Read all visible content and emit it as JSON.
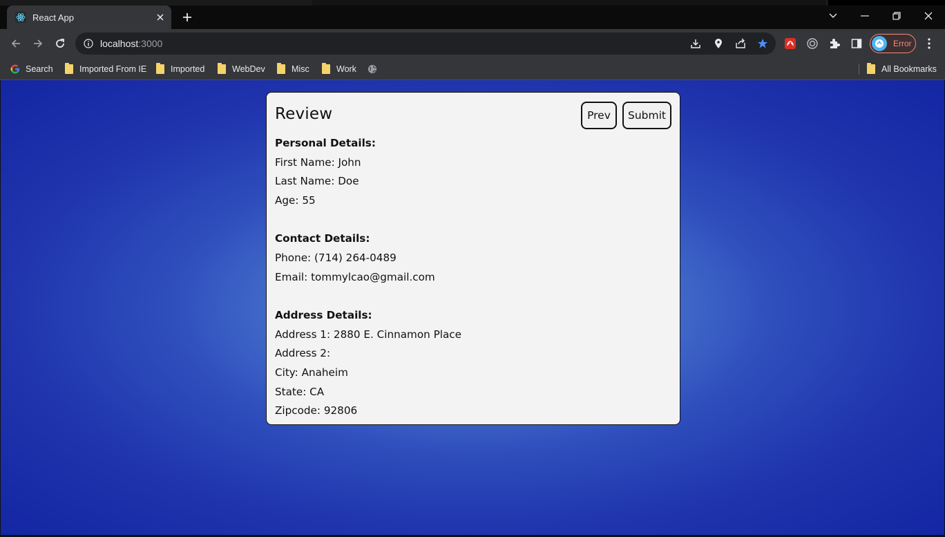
{
  "browser": {
    "tab": {
      "title": "React App",
      "icon": "react-icon"
    },
    "address": {
      "host": "localhost",
      "port": ":3000"
    },
    "profile": {
      "label": "Error"
    },
    "bookmarks": {
      "items": [
        {
          "label": "Search",
          "icon": "google-icon"
        },
        {
          "label": "Imported From IE",
          "icon": "folder-icon"
        },
        {
          "label": "Imported",
          "icon": "folder-icon"
        },
        {
          "label": "WebDev",
          "icon": "folder-icon"
        },
        {
          "label": "Misc",
          "icon": "folder-icon"
        },
        {
          "label": "Work",
          "icon": "folder-icon"
        }
      ],
      "all_label": "All Bookmarks"
    }
  },
  "review": {
    "title": "Review",
    "prev_label": "Prev",
    "submit_label": "Submit",
    "personal": {
      "heading": "Personal Details:",
      "first_name": "First Name: John",
      "last_name": "Last Name: Doe",
      "age": "Age: 55"
    },
    "contact": {
      "heading": "Contact Details:",
      "phone": "Phone: (714) 264-0489",
      "email": "Email: tommylcao@gmail.com"
    },
    "address": {
      "heading": "Address Details:",
      "address1": "Address 1: 2880 E. Cinnamon Place",
      "address2": "Address 2:",
      "city": "City: Anaheim",
      "state": "State: CA",
      "zipcode": "Zipcode: 92806"
    }
  },
  "colors": {
    "accent_star": "#4f8ef7",
    "background_center": "#6b9bd8",
    "background_edge": "#1426a3",
    "card": "#f3f3f3"
  }
}
